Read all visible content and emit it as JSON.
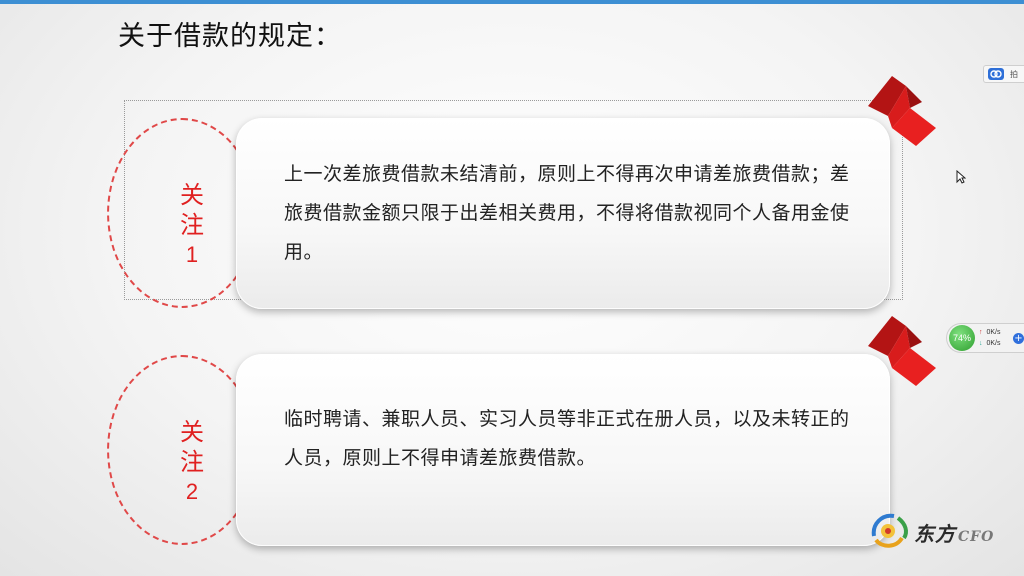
{
  "slide": {
    "title": "关于借款的规定："
  },
  "notes": [
    {
      "label": "关注",
      "number": "1",
      "text": "上一次差旅费借款未结清前，原则上不得再次申请差旅费借款；差旅费借款金额只限于出差相关费用，不得将借款视同个人备用金使用。"
    },
    {
      "label": "关注",
      "number": "2",
      "text": "临时聘请、兼职人员、实习人员等非正式在册人员，以及未转正的人员，原则上不得申请差旅费借款。"
    }
  ],
  "side_tool": {
    "label": "拍",
    "icon": "cloud-icon"
  },
  "net_widget": {
    "percent": "74%",
    "up": "0K/s",
    "down": "0K/s"
  },
  "logo": {
    "name": "东方",
    "suffix": "CFO"
  },
  "colors": {
    "accent_red": "#e02020",
    "ribbon_red": "#d81c1c",
    "topbar_blue": "#3d8fd3"
  }
}
